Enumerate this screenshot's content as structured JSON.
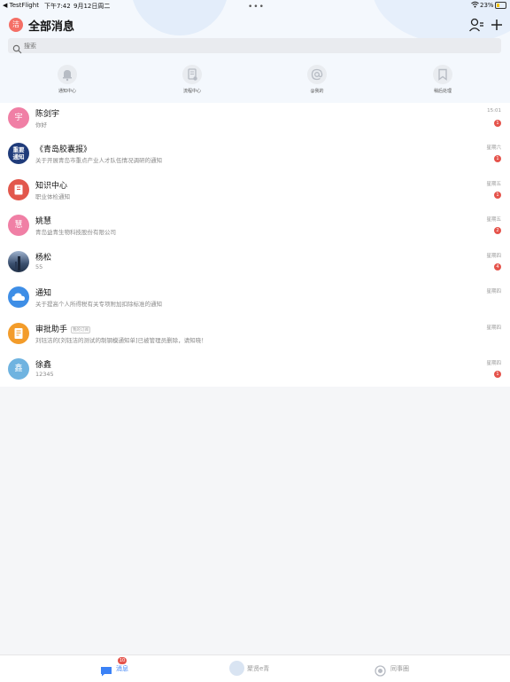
{
  "status_bar": {
    "back_app": "◀ TestFlight",
    "time": "下午7:42",
    "date": "9月12日周二",
    "battery": "23%"
  },
  "header": {
    "avatar_text": "洁",
    "title": "全部消息",
    "caret": "▾"
  },
  "search": {
    "placeholder": "搜索"
  },
  "shortcuts": [
    {
      "label": "通知中心",
      "icon": "bell-icon"
    },
    {
      "label": "流程中心",
      "icon": "flow-document-icon"
    },
    {
      "label": "@我的",
      "icon": "at-icon"
    },
    {
      "label": "稍后处理",
      "icon": "bookmark-icon"
    }
  ],
  "conversations": [
    {
      "avatar_text": "宇",
      "avatar_color": "#f07fa5",
      "name": "陈剑宇",
      "preview": "你好",
      "time": "15:01",
      "badge": "1"
    },
    {
      "avatar_text": "重要通知",
      "avatar_color": "#1f3b7a",
      "name": "《青岛胶囊报》",
      "preview": "关于开展青岛市重点产业人才队伍情况调研的通知",
      "time": "星期六",
      "badge": "1"
    },
    {
      "avatar_text": "",
      "avatar_color": "#e2574c",
      "name": "知识中心",
      "preview": "职业体检通知",
      "time": "星期五",
      "badge": "1"
    },
    {
      "avatar_text": "慧",
      "avatar_color": "#f07fa5",
      "name": "姚慧",
      "preview": "青岛益青生物科技股份有限公司",
      "time": "星期五",
      "badge": "2"
    },
    {
      "avatar_text": "",
      "avatar_color": "#3a4f6e",
      "name": "杨松",
      "preview": "55",
      "time": "星期四",
      "badge": "4"
    },
    {
      "avatar_text": "",
      "avatar_color": "#3e8ee6",
      "name": "通知",
      "preview": "关于提高个人所得税有关专项附加扣除标准的通知",
      "time": "星期四",
      "badge": ""
    },
    {
      "avatar_text": "",
      "avatar_color": "#f39c2a",
      "name": "审批助手",
      "tag": "我的订阅",
      "preview": "刘钰洁的[刘钰洁的测试的制钢模通知单]已被管理员删除，请知晓！",
      "time": "星期四",
      "badge": ""
    },
    {
      "avatar_text": "鑫",
      "avatar_color": "#6fb3e0",
      "name": "徐鑫",
      "preview": "12345",
      "time": "星期四",
      "badge": "1"
    }
  ],
  "tabbar": {
    "messages": {
      "label": "消息",
      "badge": "10",
      "color": "#3b82f6"
    },
    "center": {
      "label": "聚贤e青"
    },
    "colleagues": {
      "label": "同事圈"
    }
  }
}
